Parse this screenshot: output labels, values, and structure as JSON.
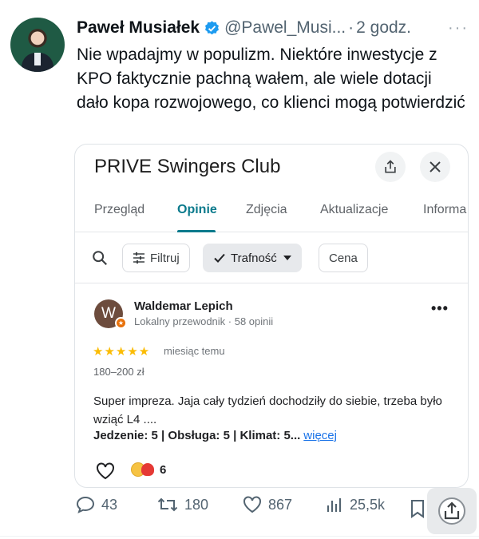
{
  "tweet": {
    "author_name": "Paweł Musiałek",
    "handle": "@Pawel_Musi...",
    "separator": "·",
    "time": "2 godz.",
    "more": "···",
    "text": "Nie wpadajmy w populizm. Niektóre inwestycje z KPO faktycznie pachną wałem, ale wiele dotacji dało kopa rozwojowego, co klienci mogą potwierdzić"
  },
  "embedded": {
    "place_title": "PRIVE Swingers Club",
    "tabs": [
      {
        "label": "Przegląd",
        "active": false
      },
      {
        "label": "Opinie",
        "active": true
      },
      {
        "label": "Zdjęcia",
        "active": false
      },
      {
        "label": "Aktualizacje",
        "active": false
      },
      {
        "label": "Informa",
        "active": false
      }
    ],
    "filters": {
      "filter_label": "Filtruj",
      "sort_label": "Trafność",
      "price_label": "Cena"
    },
    "review": {
      "avatar_letter": "W",
      "author": "Waldemar Lepich",
      "meta": "Lokalny przewodnik · 58 opinii",
      "rating": 5,
      "stars": "★★★★★",
      "date": "miesiąc temu",
      "price_range": "180–200 zł",
      "text": "Super impreza.  Jaja cały tydzień dochodziły do siebie, trzeba było wziąć L4 ....",
      "tags": "Jedzenie: 5 | Obsługa: 5 | Klimat: 5...",
      "more_link": "więcej",
      "reaction_count": "6"
    }
  },
  "actions": {
    "replies": "43",
    "retweets": "180",
    "likes": "867",
    "views": "25,5k"
  },
  "colors": {
    "verified": "#1d9bf0",
    "accent_tab": "#0b7a8c",
    "star": "#fbbc04",
    "link": "#1a73e8"
  },
  "icons": [
    "verified-badge-icon",
    "share-icon",
    "close-icon",
    "search-icon",
    "filter-icon",
    "check-icon",
    "dropdown-icon",
    "more-icon",
    "like-icon",
    "reply-icon",
    "retweet-icon",
    "heart-icon",
    "views-icon",
    "bookmark-icon"
  ]
}
